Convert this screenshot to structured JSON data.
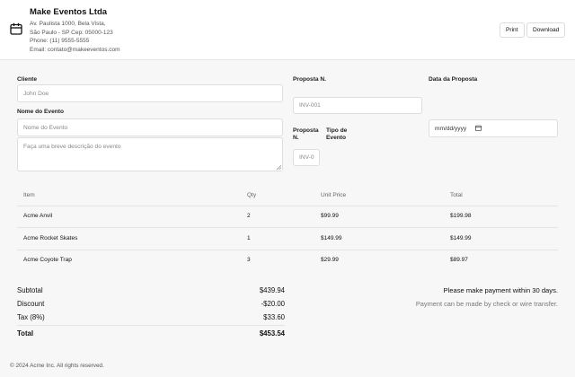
{
  "header": {
    "company": "Make Eventos Ltda",
    "address_lines": [
      "Av. Paulista 1000, Bela Vista,",
      "São Paulo - SP Cep: 05000-123",
      "Phone: (11) 9555-5555",
      "Email: contato@makeeventos.com"
    ],
    "print_label": "Print",
    "download_label": "Download",
    "icon": "calendar-icon"
  },
  "form": {
    "client_label": "Cliente",
    "client_placeholder": "John Doe",
    "event_name_label": "Nome do Evento",
    "event_name_placeholder": "Nome do Evento",
    "description_placeholder": "Faça uma breve descrição do evento",
    "proposal_label": "Proposta N.",
    "proposal_placeholder": "INV-001",
    "proposal_small_label": "Proposta N.",
    "proposal_small_placeholder": "INV-0",
    "event_type_label": "Tipo de Evento",
    "proposal_date_label": "Data da Proposta",
    "date_value": "mm/dd/yyyy"
  },
  "table": {
    "headers": [
      "Item",
      "Qty",
      "Unit Price",
      "Total"
    ],
    "rows": [
      {
        "item": "Acme Anvil",
        "qty": "2",
        "unit": "$99.99",
        "total": "$199.98"
      },
      {
        "item": "Acme Rocket Skates",
        "qty": "1",
        "unit": "$149.99",
        "total": "$149.99"
      },
      {
        "item": "Acme Coyote Trap",
        "qty": "3",
        "unit": "$29.99",
        "total": "$89.97"
      }
    ]
  },
  "summary": {
    "subtotal_label": "Subtotal",
    "subtotal": "$439.94",
    "discount_label": "Discount",
    "discount": "-$20.00",
    "tax_label": "Tax (8%)",
    "tax": "$33.60",
    "total_label": "Total",
    "total": "$453.54"
  },
  "notes": {
    "line1": "Please make payment within 30 days.",
    "line2": "Payment can be made by check or wire transfer."
  },
  "footer": "© 2024 Acme Inc. All rights reserved."
}
